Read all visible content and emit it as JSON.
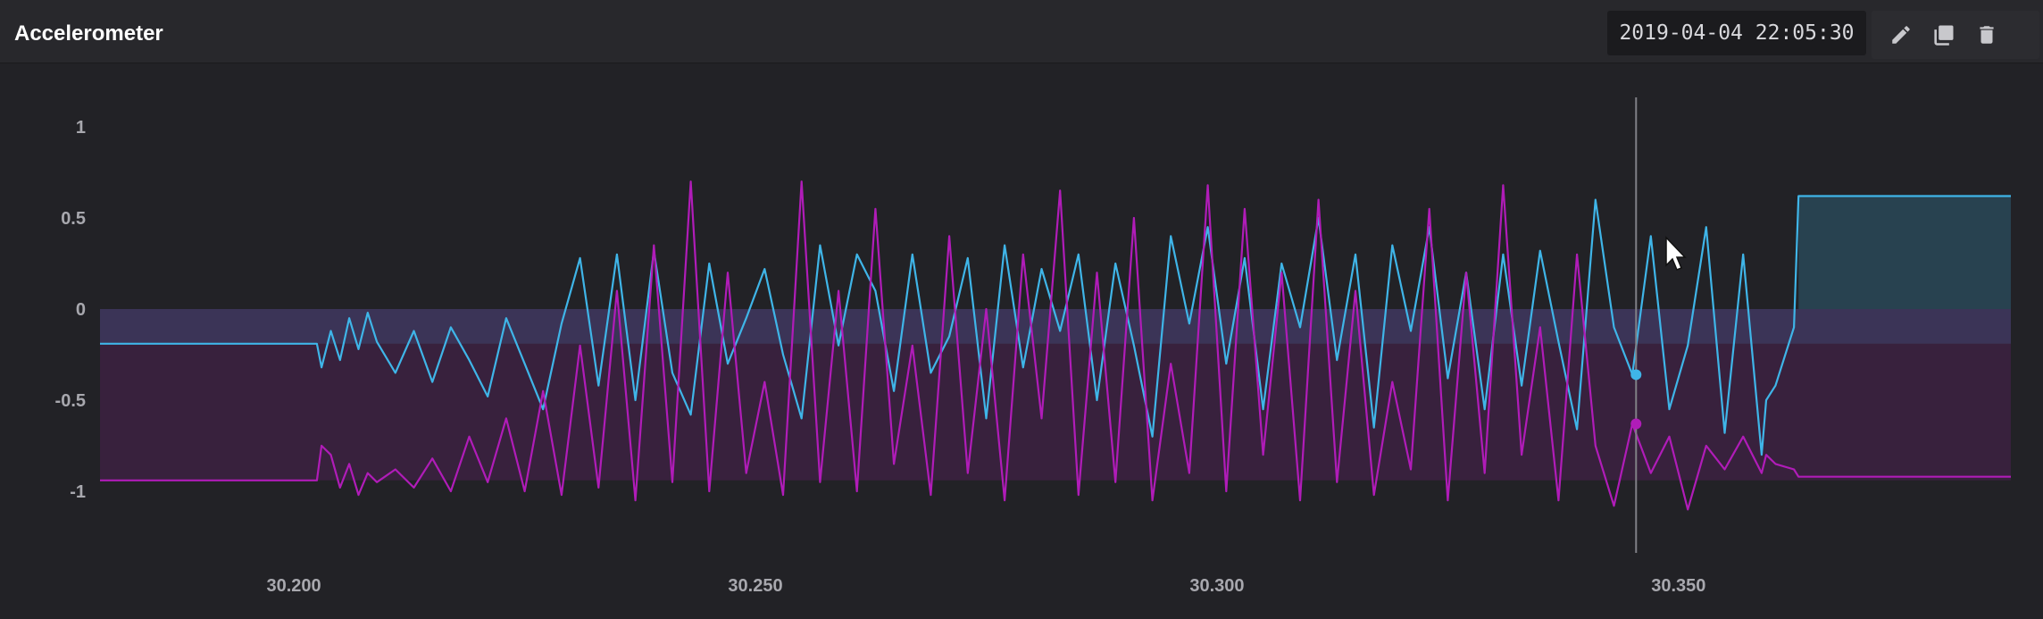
{
  "panel": {
    "title": "Accelerometer",
    "timestamp": "2019-04-04 22:05:30"
  },
  "toolbar": {
    "edit_icon": "pencil-icon",
    "duplicate_icon": "copy-icon",
    "delete_icon": "trash-icon"
  },
  "colors": {
    "background": "#222226",
    "series_x": "#3fb5e8",
    "series_y": "#b01cb8",
    "cursor_line": "#808086"
  },
  "chart_data": {
    "type": "line",
    "title": "Accelerometer",
    "xlabel": "",
    "ylabel": "",
    "xlim": [
      30.179,
      30.386
    ],
    "ylim": [
      -1.25,
      1.25
    ],
    "x_ticks": [
      30.2,
      30.25,
      30.3,
      30.35
    ],
    "x_tick_labels": [
      "30.200",
      "30.250",
      "30.300",
      "30.350"
    ],
    "y_ticks": [
      1,
      0.5,
      0,
      -0.5,
      -1
    ],
    "y_tick_labels": [
      "1",
      "0.5",
      "0",
      "-0.5",
      "-1"
    ],
    "grid": false,
    "legend": "none",
    "hover_x": 30.3454,
    "hover_values": [
      -0.36,
      -0.63
    ],
    "series": [
      {
        "color": "#3fb5e8",
        "fill_to_zero": true,
        "x": [
          30.179,
          30.2025,
          30.203,
          30.204,
          30.205,
          30.206,
          30.207,
          30.208,
          30.209,
          30.211,
          30.213,
          30.215,
          30.217,
          30.219,
          30.221,
          30.223,
          30.225,
          30.227,
          30.229,
          30.231,
          30.233,
          30.235,
          30.237,
          30.239,
          30.241,
          30.243,
          30.245,
          30.247,
          30.249,
          30.251,
          30.253,
          30.255,
          30.257,
          30.259,
          30.261,
          30.263,
          30.265,
          30.267,
          30.269,
          30.271,
          30.273,
          30.275,
          30.277,
          30.279,
          30.281,
          30.283,
          30.285,
          30.287,
          30.289,
          30.291,
          30.293,
          30.295,
          30.297,
          30.299,
          30.301,
          30.303,
          30.305,
          30.307,
          30.309,
          30.311,
          30.313,
          30.315,
          30.317,
          30.319,
          30.321,
          30.323,
          30.325,
          30.327,
          30.329,
          30.331,
          30.333,
          30.335,
          30.337,
          30.339,
          30.341,
          30.343,
          30.345,
          30.347,
          30.349,
          30.351,
          30.353,
          30.355,
          30.357,
          30.359,
          30.3595,
          30.3605,
          30.3625,
          30.363,
          30.386
        ],
        "y": [
          -0.19,
          -0.19,
          -0.32,
          -0.12,
          -0.28,
          -0.05,
          -0.22,
          -0.02,
          -0.18,
          -0.35,
          -0.12,
          -0.4,
          -0.1,
          -0.28,
          -0.48,
          -0.05,
          -0.3,
          -0.55,
          -0.08,
          0.28,
          -0.42,
          0.3,
          -0.5,
          0.32,
          -0.35,
          -0.58,
          0.25,
          -0.3,
          -0.05,
          0.22,
          -0.25,
          -0.6,
          0.35,
          -0.2,
          0.3,
          0.1,
          -0.45,
          0.3,
          -0.35,
          -0.15,
          0.28,
          -0.6,
          0.35,
          -0.32,
          0.22,
          -0.12,
          0.3,
          -0.5,
          0.25,
          -0.2,
          -0.7,
          0.4,
          -0.08,
          0.45,
          -0.3,
          0.28,
          -0.55,
          0.25,
          -0.1,
          0.5,
          -0.28,
          0.3,
          -0.65,
          0.35,
          -0.12,
          0.45,
          -0.38,
          0.2,
          -0.55,
          0.3,
          -0.42,
          0.32,
          -0.18,
          -0.66,
          0.6,
          -0.1,
          -0.36,
          0.4,
          -0.55,
          -0.2,
          0.45,
          -0.68,
          0.3,
          -0.8,
          -0.5,
          -0.42,
          -0.1,
          0.62,
          0.62
        ]
      },
      {
        "color": "#b01cb8",
        "fill_to_zero": true,
        "x": [
          30.179,
          30.2025,
          30.203,
          30.204,
          30.205,
          30.206,
          30.207,
          30.208,
          30.209,
          30.211,
          30.213,
          30.215,
          30.217,
          30.219,
          30.221,
          30.223,
          30.225,
          30.227,
          30.229,
          30.231,
          30.233,
          30.235,
          30.237,
          30.239,
          30.241,
          30.243,
          30.245,
          30.247,
          30.249,
          30.251,
          30.253,
          30.255,
          30.257,
          30.259,
          30.261,
          30.263,
          30.265,
          30.267,
          30.269,
          30.271,
          30.273,
          30.275,
          30.277,
          30.279,
          30.281,
          30.283,
          30.285,
          30.287,
          30.289,
          30.291,
          30.293,
          30.295,
          30.297,
          30.299,
          30.301,
          30.303,
          30.305,
          30.307,
          30.309,
          30.311,
          30.313,
          30.315,
          30.317,
          30.319,
          30.321,
          30.323,
          30.325,
          30.327,
          30.329,
          30.331,
          30.333,
          30.335,
          30.337,
          30.339,
          30.341,
          30.343,
          30.345,
          30.347,
          30.349,
          30.351,
          30.353,
          30.355,
          30.357,
          30.359,
          30.3595,
          30.3605,
          30.3625,
          30.363,
          30.386
        ],
        "y": [
          -0.94,
          -0.94,
          -0.75,
          -0.8,
          -0.98,
          -0.85,
          -1.02,
          -0.9,
          -0.95,
          -0.88,
          -0.98,
          -0.82,
          -1.0,
          -0.7,
          -0.95,
          -0.6,
          -1.0,
          -0.45,
          -1.02,
          -0.2,
          -0.98,
          0.1,
          -1.05,
          0.35,
          -0.95,
          0.7,
          -1.0,
          0.2,
          -0.9,
          -0.4,
          -1.02,
          0.7,
          -0.95,
          0.1,
          -1.0,
          0.55,
          -0.85,
          -0.2,
          -1.02,
          0.4,
          -0.9,
          0.0,
          -1.05,
          0.3,
          -0.6,
          0.65,
          -1.02,
          0.2,
          -0.95,
          0.5,
          -1.05,
          -0.3,
          -0.9,
          0.68,
          -1.0,
          0.55,
          -0.8,
          0.2,
          -1.05,
          0.6,
          -0.95,
          0.1,
          -1.02,
          -0.4,
          -0.88,
          0.55,
          -1.05,
          0.2,
          -0.9,
          0.68,
          -0.8,
          -0.1,
          -1.05,
          0.3,
          -0.75,
          -1.08,
          -0.63,
          -0.9,
          -0.7,
          -1.1,
          -0.75,
          -0.88,
          -0.7,
          -0.9,
          -0.8,
          -0.85,
          -0.88,
          -0.92,
          -0.92
        ]
      }
    ]
  }
}
